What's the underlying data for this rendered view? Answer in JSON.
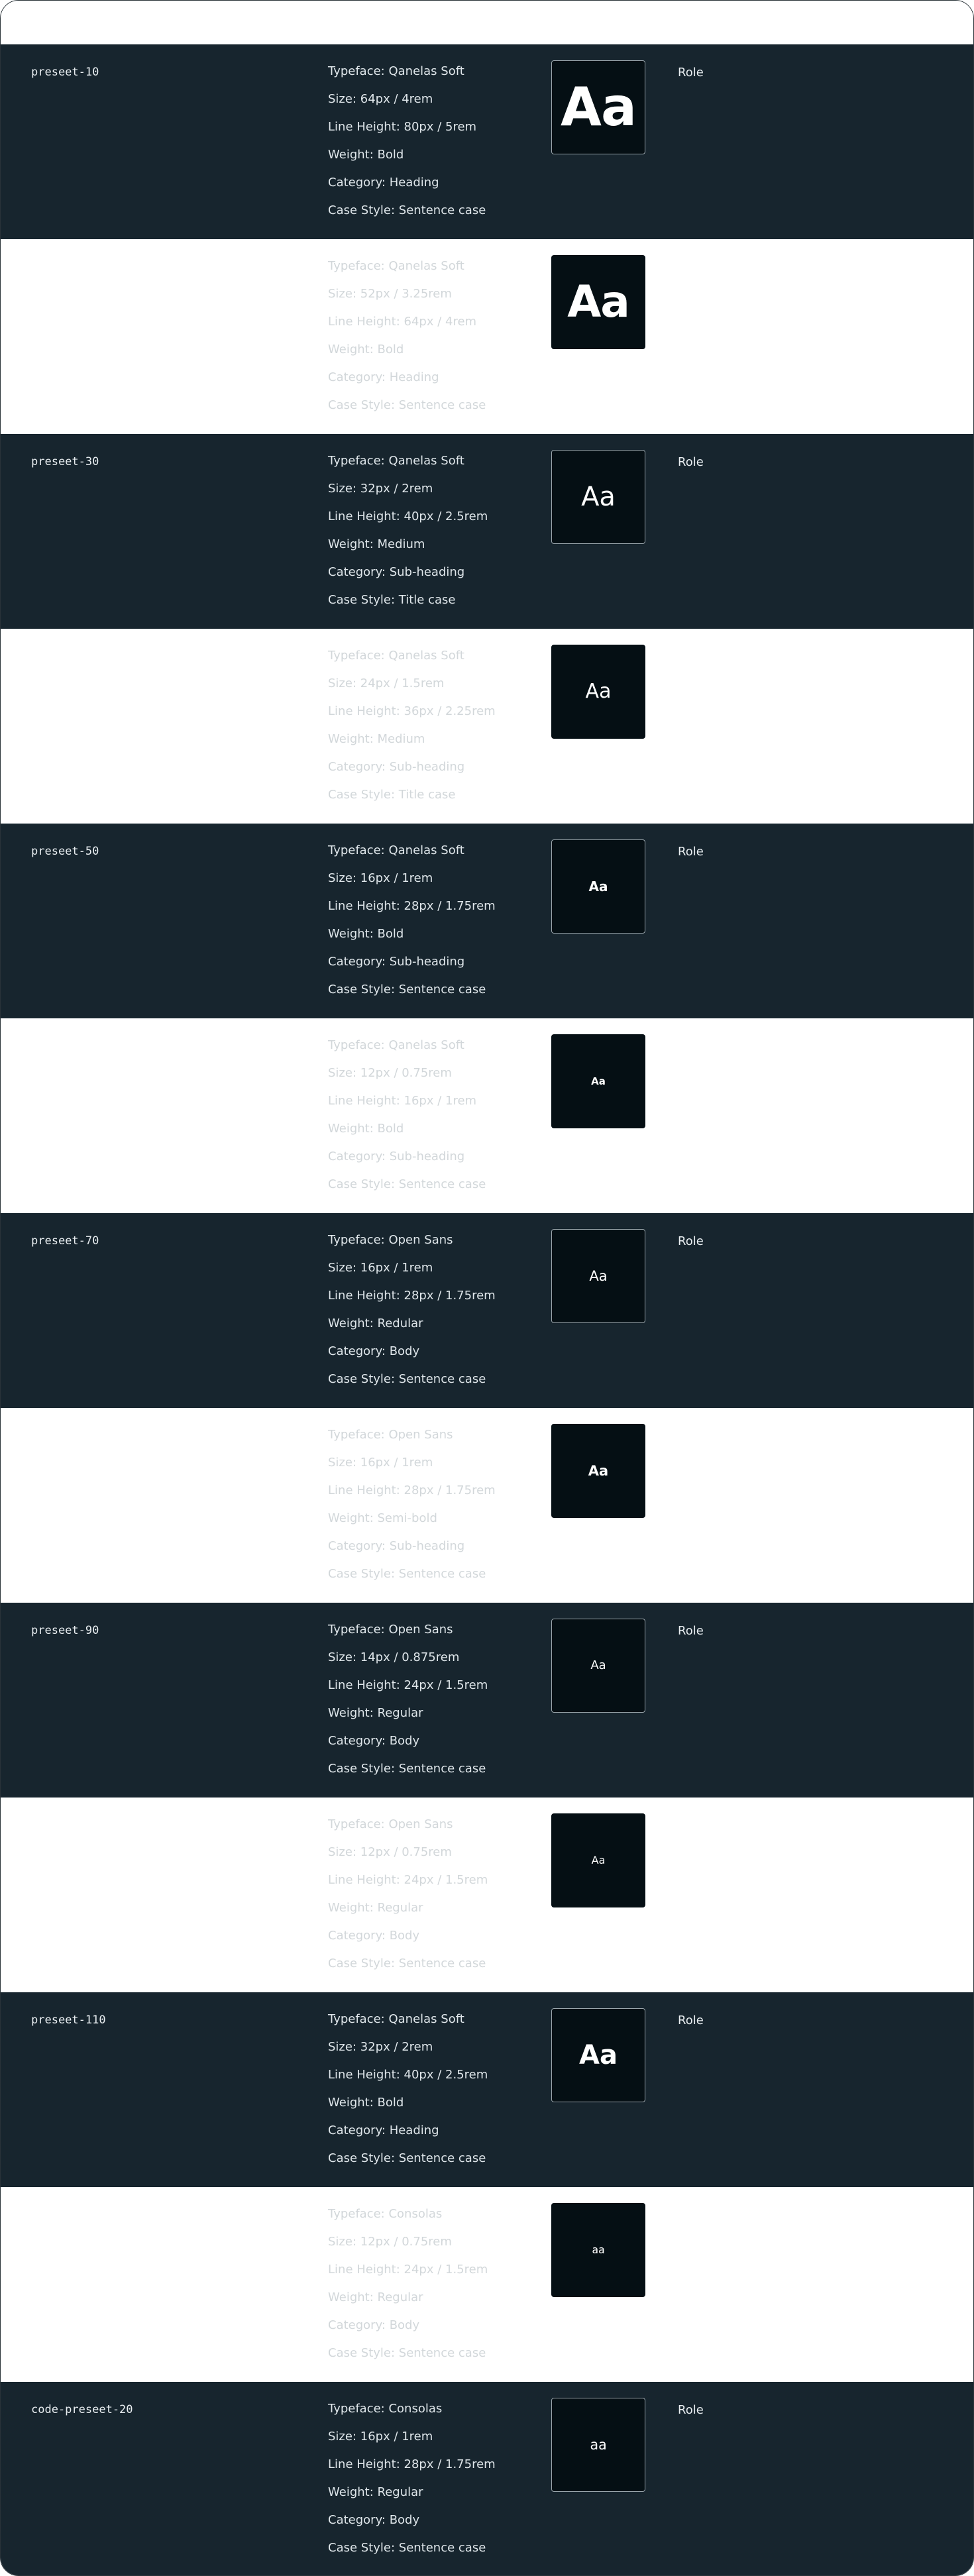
{
  "colors": {
    "dark_row": "#17252e",
    "light_row": "#ffffff",
    "sample_bg": "#050f14"
  },
  "rows": [
    {
      "name": "preseet-10",
      "typeface": "Typeface: Qanelas Soft",
      "size": "Size: 64px / 4rem",
      "line_height": "Line Height: 80px / 5rem",
      "weight": "Weight: Bold",
      "category": "Category: Heading",
      "case_style": "Case Style: Sentence case",
      "sample": "Aa",
      "role": "Role"
    },
    {
      "typeface": "Typeface: Qanelas Soft",
      "size": "Size: 52px / 3.25rem",
      "line_height": "Line Height: 64px / 4rem",
      "weight": "Weight: Bold",
      "category": "Category: Heading",
      "case_style": "Case Style: Sentence case",
      "sample": "Aa"
    },
    {
      "name": "preseet-30",
      "typeface": "Typeface: Qanelas Soft",
      "size": "Size: 32px / 2rem",
      "line_height": "Line Height: 40px / 2.5rem",
      "weight": "Weight: Medium",
      "category": "Category: Sub-heading",
      "case_style": "Case Style: Title case",
      "sample": "Aa",
      "role": "Role"
    },
    {
      "typeface": "Typeface: Qanelas Soft",
      "size": "Size: 24px / 1.5rem",
      "line_height": "Line Height: 36px / 2.25rem",
      "weight": "Weight: Medium",
      "category": "Category: Sub-heading",
      "case_style": "Case Style: Title case",
      "sample": "Aa"
    },
    {
      "name": "preseet-50",
      "typeface": "Typeface: Qanelas Soft",
      "size": "Size: 16px / 1rem",
      "line_height": "Line Height: 28px / 1.75rem",
      "weight": "Weight: Bold",
      "category": "Category: Sub-heading",
      "case_style": "Case Style: Sentence case",
      "sample": "Aa",
      "role": "Role"
    },
    {
      "typeface": "Typeface: Qanelas Soft",
      "size": "Size: 12px / 0.75rem",
      "line_height": "Line Height: 16px / 1rem",
      "weight": "Weight: Bold",
      "category": "Category: Sub-heading",
      "case_style": "Case Style: Sentence case",
      "sample": "Aa"
    },
    {
      "name": "preseet-70",
      "typeface": "Typeface: Open Sans",
      "size": "Size: 16px / 1rem",
      "line_height": "Line Height: 28px / 1.75rem",
      "weight": "Weight: Redular",
      "category": "Category: Body",
      "case_style": "Case Style: Sentence case",
      "sample": "Aa",
      "role": "Role"
    },
    {
      "typeface": "Typeface: Open Sans",
      "size": "Size: 16px / 1rem",
      "line_height": "Line Height: 28px / 1.75rem",
      "weight": "Weight: Semi-bold",
      "category": "Category: Sub-heading",
      "case_style": "Case Style: Sentence case",
      "sample": "Aa"
    },
    {
      "name": "preseet-90",
      "typeface": "Typeface: Open Sans",
      "size": "Size: 14px / 0.875rem",
      "line_height": "Line Height: 24px / 1.5rem",
      "weight": "Weight: Regular",
      "category": "Category: Body",
      "case_style": "Case Style: Sentence case",
      "sample": "Aa",
      "role": "Role"
    },
    {
      "typeface": "Typeface: Open Sans",
      "size": "Size: 12px / 0.75rem",
      "line_height": "Line Height: 24px / 1.5rem",
      "weight": "Weight: Regular",
      "category": "Category: Body",
      "case_style": "Case Style: Sentence case",
      "sample": "Aa"
    },
    {
      "name": "preseet-110",
      "typeface": "Typeface: Qanelas Soft",
      "size": "Size: 32px / 2rem",
      "line_height": "Line Height: 40px / 2.5rem",
      "weight": "Weight: Bold",
      "category": "Category: Heading",
      "case_style": "Case Style: Sentence case",
      "sample": "Aa",
      "role": "Role"
    },
    {
      "typeface": "Typeface: Consolas",
      "size": "Size: 12px / 0.75rem",
      "line_height": "Line Height: 24px / 1.5rem",
      "weight": "Weight: Regular",
      "category": "Category: Body",
      "case_style": "Case Style: Sentence case",
      "sample": "aa"
    },
    {
      "name": "code-preseet-20",
      "typeface": "Typeface: Consolas",
      "size": "Size: 16px / 1rem",
      "line_height": "Line Height: 28px / 1.75rem",
      "weight": "Weight: Regular",
      "category": "Category: Body",
      "case_style": "Case Style: Sentence case",
      "sample": "aa",
      "role": "Role"
    }
  ]
}
